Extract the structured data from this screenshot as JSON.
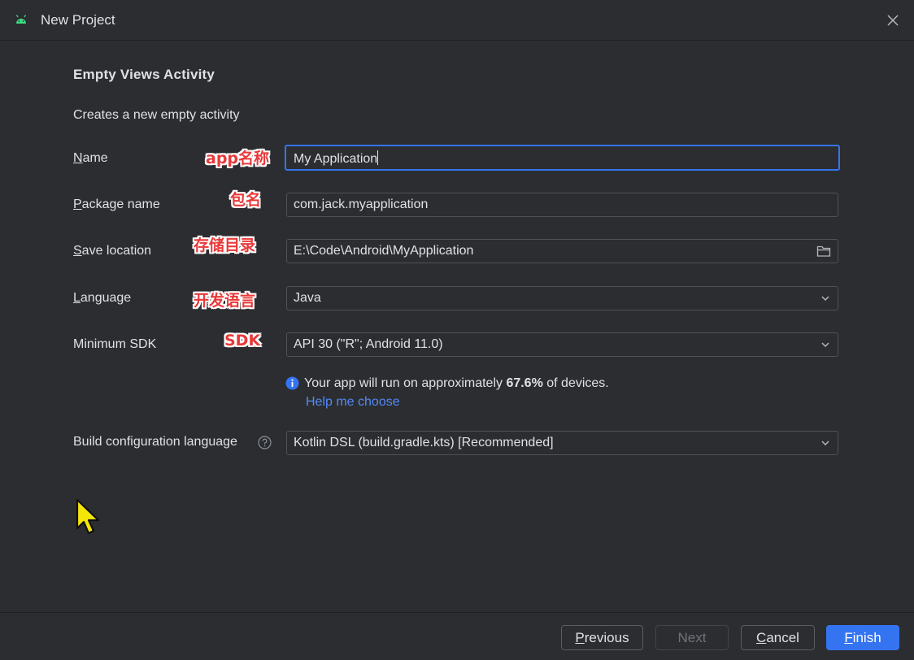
{
  "window": {
    "title": "New Project",
    "app_icon": "android-icon",
    "close_icon": "close-icon"
  },
  "heading": "Empty Views Activity",
  "description": "Creates a new empty activity",
  "form": {
    "name": {
      "label_mnemonic": "N",
      "label_rest": "ame",
      "value": "My Application",
      "annotation": "app名称"
    },
    "package": {
      "label_mnemonic": "P",
      "label_rest": "ackage name",
      "value": "com.jack.myapplication",
      "annotation": "包名"
    },
    "save_location": {
      "label_mnemonic": "S",
      "label_rest": "ave location",
      "value": "E:\\Code\\Android\\MyApplication",
      "annotation": "存储目录",
      "icon": "folder-icon"
    },
    "language": {
      "label_mnemonic": "L",
      "label_rest": "anguage",
      "value": "Java",
      "annotation": "开发语言"
    },
    "min_sdk": {
      "label": "Minimum SDK",
      "value": "API 30 (\"R\"; Android 11.0)",
      "annotation": "SDK"
    },
    "info": {
      "prefix": "Your app will run on approximately ",
      "percent": "67.6%",
      "suffix": " of devices.",
      "link": "Help me choose"
    },
    "build_config": {
      "label": "Build configuration language",
      "value": "Kotlin DSL (build.gradle.kts) [Recommended]"
    }
  },
  "buttons": {
    "previous": {
      "mnemonic": "P",
      "rest": "revious"
    },
    "next": "Next",
    "cancel": {
      "mnemonic": "C",
      "rest": "ancel"
    },
    "finish": {
      "mnemonic": "F",
      "rest": "inish"
    }
  },
  "colors": {
    "background": "#2b2d30",
    "accent": "#3574f0",
    "link": "#548af7",
    "annotation": "#e8393a",
    "android_green": "#3ddc84"
  }
}
